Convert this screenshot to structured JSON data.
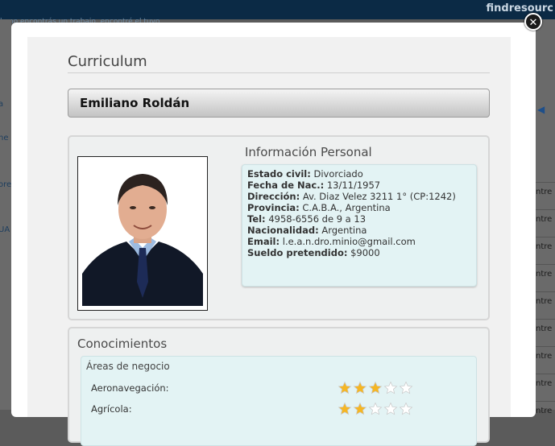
{
  "background": {
    "brand": "findresourc",
    "ticker": "le no encontrás un trabajo, encontré el tuyo",
    "left_items": [
      "a",
      "ne",
      "ore",
      "UA"
    ],
    "right_cells": [
      "ntre",
      "ntre",
      "ntre",
      "ntre",
      "ntre",
      "ntre",
      "ntre",
      "ntre",
      "ntre",
      "ntre"
    ]
  },
  "modal": {
    "close_label": "✕",
    "title": "Curriculum",
    "name": "Emiliano Roldán",
    "personal": {
      "heading": "Información Personal",
      "rows": [
        {
          "label": "Estado civil:",
          "value": "Divorciado"
        },
        {
          "label": "Fecha de Nac.:",
          "value": "13/11/1957"
        },
        {
          "label": "Dirección:",
          "value": "Av. Diaz Velez 3211 1°  (CP:1242)"
        },
        {
          "label": "Provincia:",
          "value": "C.A.B.A., Argentina"
        },
        {
          "label": "Tel:",
          "value": "4958-6556 de 9 a 13"
        },
        {
          "label": "Nacionalidad:",
          "value": "Argentina"
        },
        {
          "label": "Email:",
          "value": "l.e.a.n.dro.minio@gmail.com"
        },
        {
          "label": "Sueldo pretendido:",
          "value": "$9000"
        }
      ]
    },
    "skills": {
      "heading": "Conocimientos",
      "area": "Áreas de negocio",
      "items": [
        {
          "label": "Aeronavegación:",
          "rating": 3,
          "max": 5
        },
        {
          "label": "Agrícola:",
          "rating": 2,
          "max": 5
        }
      ]
    }
  },
  "colors": {
    "star_filled": "#f5b623",
    "star_empty": "#ffffff",
    "info_bg": "#e3f3f4"
  }
}
